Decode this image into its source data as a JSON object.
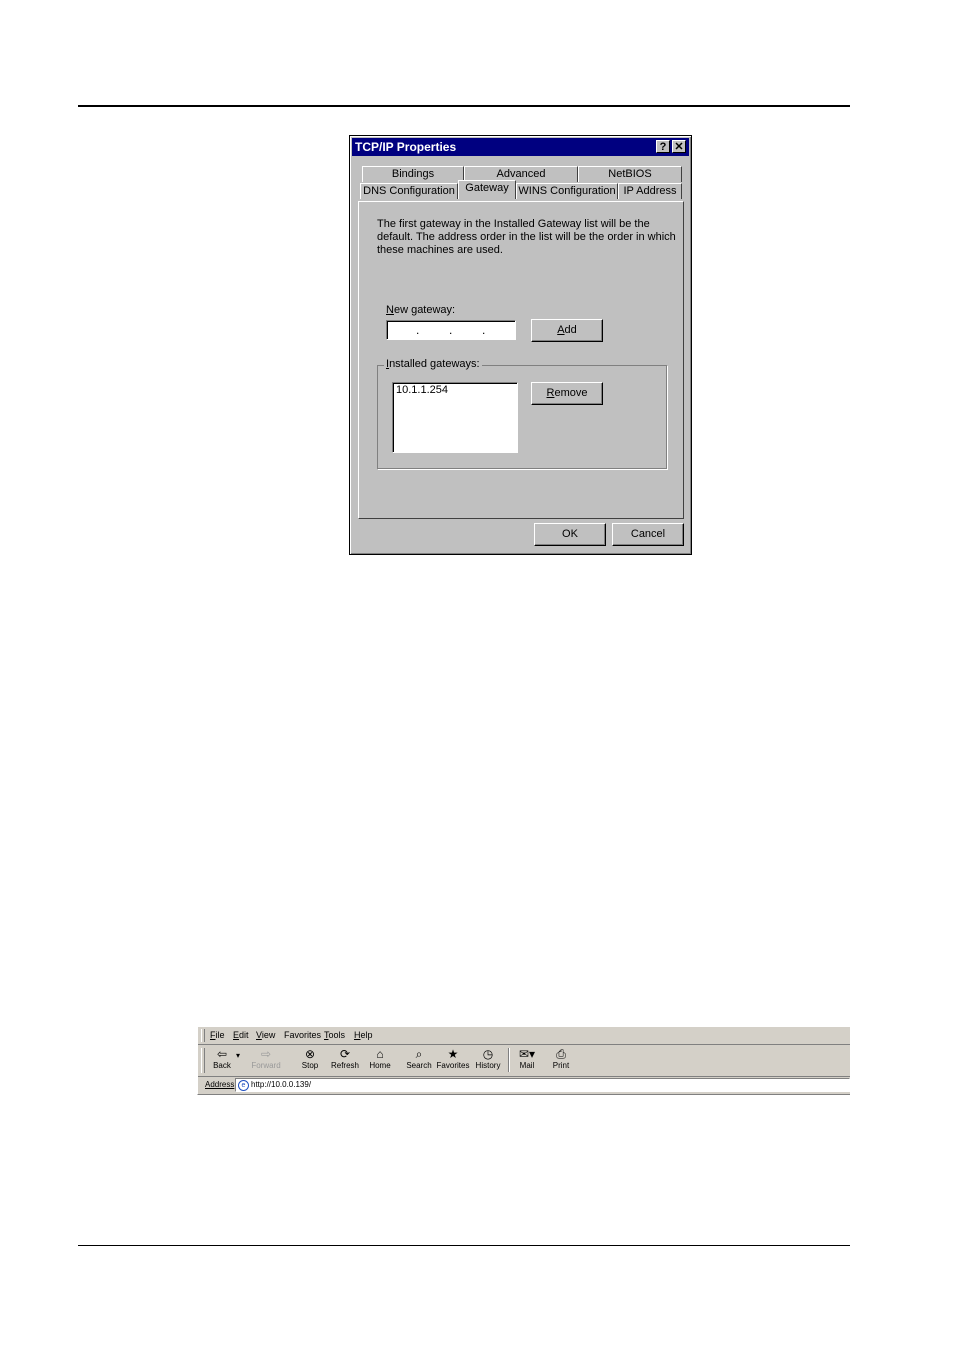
{
  "dialog": {
    "title": "TCP/IP Properties",
    "help_glyph": "?",
    "close_glyph": "✕",
    "tabs_back": [
      "Bindings",
      "Advanced",
      "NetBIOS"
    ],
    "tabs_front": [
      "DNS Configuration",
      "Gateway",
      "WINS Configuration",
      "IP Address"
    ],
    "active_tab": "Gateway",
    "description": "The first gateway in the Installed Gateway list will be the default. The address order in the list will be the order in which these machines are used.",
    "new_gateway_label_u": "N",
    "new_gateway_label_rest": "ew gateway:",
    "ip_dots": ".",
    "add_label_u": "A",
    "add_label_rest": "dd",
    "installed_label_u": "I",
    "installed_label_rest": "nstalled gateways:",
    "installed_gateways": [
      "10.1.1.254"
    ],
    "remove_label_u": "R",
    "remove_label_rest": "emove",
    "ok_label": "OK",
    "cancel_label": "Cancel"
  },
  "browser": {
    "menus": [
      {
        "u": "F",
        "rest": "ile"
      },
      {
        "u": "E",
        "rest": "dit"
      },
      {
        "u": "V",
        "rest": "iew"
      },
      {
        "u": "",
        "rest": "Favorites"
      },
      {
        "u": "T",
        "rest": "ools"
      },
      {
        "u": "H",
        "rest": "elp"
      }
    ],
    "tools": [
      {
        "label": "Back",
        "icon": "back-arrow-icon"
      },
      {
        "label": "Forward",
        "icon": "forward-arrow-icon"
      },
      {
        "label": "Stop",
        "icon": "stop-icon"
      },
      {
        "label": "Refresh",
        "icon": "refresh-icon"
      },
      {
        "label": "Home",
        "icon": "home-icon"
      },
      {
        "label": "Search",
        "icon": "search-icon"
      },
      {
        "label": "Favorites",
        "icon": "favorites-icon"
      },
      {
        "label": "History",
        "icon": "history-icon"
      },
      {
        "label": "Mail",
        "icon": "mail-icon"
      },
      {
        "label": "Print",
        "icon": "print-icon"
      }
    ],
    "address_label": "Address",
    "address_value": "http://10.0.0.139/"
  }
}
